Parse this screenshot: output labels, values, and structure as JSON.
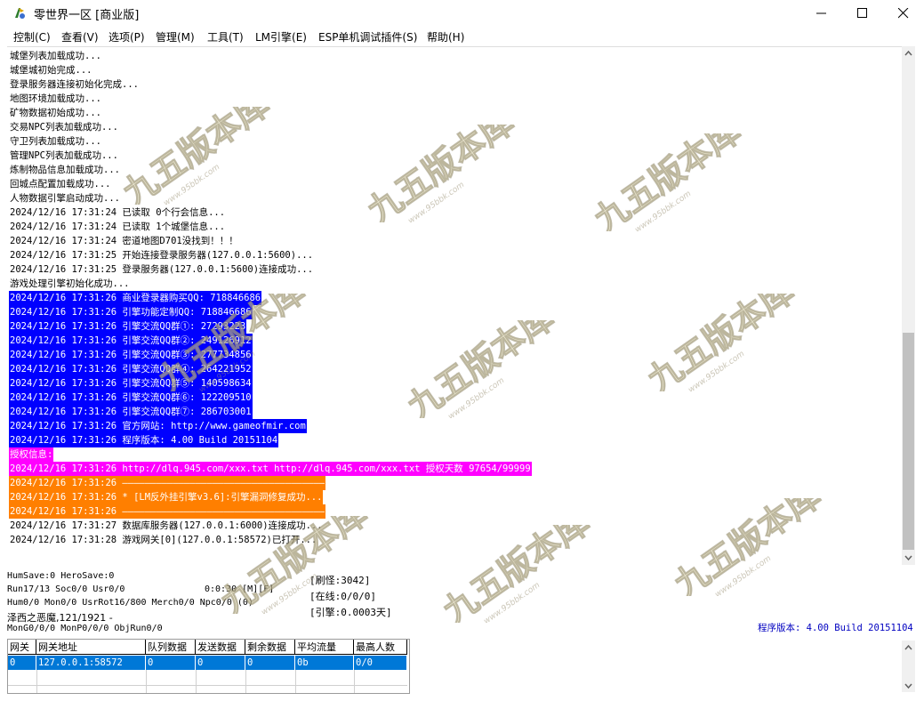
{
  "window": {
    "title": "零世界一区 [商业版]"
  },
  "menu": [
    {
      "label": "控制(C)"
    },
    {
      "label": "查看(V)"
    },
    {
      "label": "选项(P)"
    },
    {
      "label": "管理(M)"
    },
    {
      "label": "工具(T)"
    },
    {
      "label": "LM引擎(E)"
    },
    {
      "label": "ESP单机调试插件(S)"
    },
    {
      "label": "帮助(H)"
    }
  ],
  "log": {
    "lines": [
      {
        "text": "城堡列表加载成功...",
        "style": "normal"
      },
      {
        "text": "城堡城初始完成...",
        "style": "normal"
      },
      {
        "text": "登录服务器连接初始化完成...",
        "style": "normal"
      },
      {
        "text": "地图环境加载成功...",
        "style": "normal"
      },
      {
        "text": "矿物数据初始成功...",
        "style": "normal"
      },
      {
        "text": "交易NPC列表加载成功...",
        "style": "normal"
      },
      {
        "text": "守卫列表加载成功...",
        "style": "normal"
      },
      {
        "text": "管理NPC列表加载成功...",
        "style": "normal"
      },
      {
        "text": "炼制物品信息加载成功...",
        "style": "normal"
      },
      {
        "text": "回城点配置加载成功...",
        "style": "normal"
      },
      {
        "text": "人物数据引擎启动成功...",
        "style": "normal"
      },
      {
        "text": "2024/12/16 17:31:24 已读取 0个行会信息...",
        "style": "normal"
      },
      {
        "text": "2024/12/16 17:31:24 已读取 1个城堡信息...",
        "style": "normal"
      },
      {
        "text": "2024/12/16 17:31:24 密道地图D701没找到！！！",
        "style": "normal"
      },
      {
        "text": "2024/12/16 17:31:25 开始连接登录服务器(127.0.0.1:5600)...",
        "style": "normal"
      },
      {
        "text": "2024/12/16 17:31:25 登录服务器(127.0.0.1:5600)连接成功...",
        "style": "normal"
      },
      {
        "text": "游戏处理引擎初始化成功...",
        "style": "normal"
      },
      {
        "text": "2024/12/16 17:31:26 商业登录器购买QQ: 718846686",
        "style": "blue"
      },
      {
        "text": "2024/12/16 17:31:26 引擎功能定制QQ: 718846686",
        "style": "blue"
      },
      {
        "text": "2024/12/16 17:31:26 引擎交流QQ群①: 27293223",
        "style": "blue"
      },
      {
        "text": "2024/12/16 17:31:26 引擎交流QQ群②: 249126912",
        "style": "blue"
      },
      {
        "text": "2024/12/16 17:31:26 引擎交流QQ群③: 277734856",
        "style": "blue"
      },
      {
        "text": "2024/12/16 17:31:26 引擎交流QQ群④: 264221952",
        "style": "blue"
      },
      {
        "text": "2024/12/16 17:31:26 引擎交流QQ群⑤: 140598634",
        "style": "blue"
      },
      {
        "text": "2024/12/16 17:31:26 引擎交流QQ群⑥: 122209510",
        "style": "blue"
      },
      {
        "text": "2024/12/16 17:31:26 引擎交流QQ群⑦: 286703001",
        "style": "blue"
      },
      {
        "text": "2024/12/16 17:31:26 官方网站: http://www.gameofmir.com",
        "style": "blue"
      },
      {
        "text": "2024/12/16 17:31:26 程序版本: 4.00 Build 20151104",
        "style": "blue"
      },
      {
        "text": "授权信息:",
        "style": "magenta"
      },
      {
        "text": "2024/12/16 17:31:26 http://dlq.945.com/xxx.txt http://dlq.945.com/xxx.txt 授权天数 97654/99999",
        "style": "magenta"
      },
      {
        "text": "2024/12/16 17:31:26 ————————————————————————————————————",
        "style": "orange"
      },
      {
        "text": "2024/12/16 17:31:26 * [LM反外挂引擎v3.6]:引擎漏洞修复成功...",
        "style": "orange"
      },
      {
        "text": "2024/12/16 17:31:26 ————————————————————————————————————",
        "style": "orange"
      },
      {
        "text": "2024/12/16 17:31:27 数据库服务器(127.0.0.1:6000)连接成功...",
        "style": "normal"
      },
      {
        "text": "2024/12/16 17:31:28 游戏网关[0](127.0.0.1:58572)已打开...",
        "style": "normal"
      }
    ]
  },
  "status": {
    "humsave": "HumSave:0 HeroSave:0",
    "run": "Run17/13 Soc0/0 Usr0/0",
    "timer": "0:0:30 [M][F]",
    "hum": "Hum0/0 Mon0/0 UsrRot16/800 Merch0/0 Npc0/0 (0)",
    "monster": "泽西之恶魔,121/1921 -",
    "mong": "MonG0/0/0 MonP0/0/0 ObjRun0/0",
    "refresh": "[刷怪:3042]",
    "online": "[在线:0/0/0]",
    "engine": "[引擎:0.0003天]",
    "version": "程序版本: 4.00 Build 20151104"
  },
  "gateway_table": {
    "headers": [
      "网关",
      "网关地址",
      "队列数据",
      "发送数据",
      "剩余数据",
      "平均流量",
      "最高人数"
    ],
    "rows": [
      [
        "0",
        "127.0.0.1:58572",
        "0",
        "0",
        "0",
        "0b",
        "0/0"
      ]
    ]
  },
  "watermark": {
    "text": "九五版本库",
    "url": "www.95bbk.com"
  },
  "colors": {
    "highlight_blue": "#0000ff",
    "highlight_magenta": "#ff00ff",
    "highlight_orange": "#ff7f00",
    "version_blue": "#0000c0",
    "selection": "#0078d7"
  }
}
